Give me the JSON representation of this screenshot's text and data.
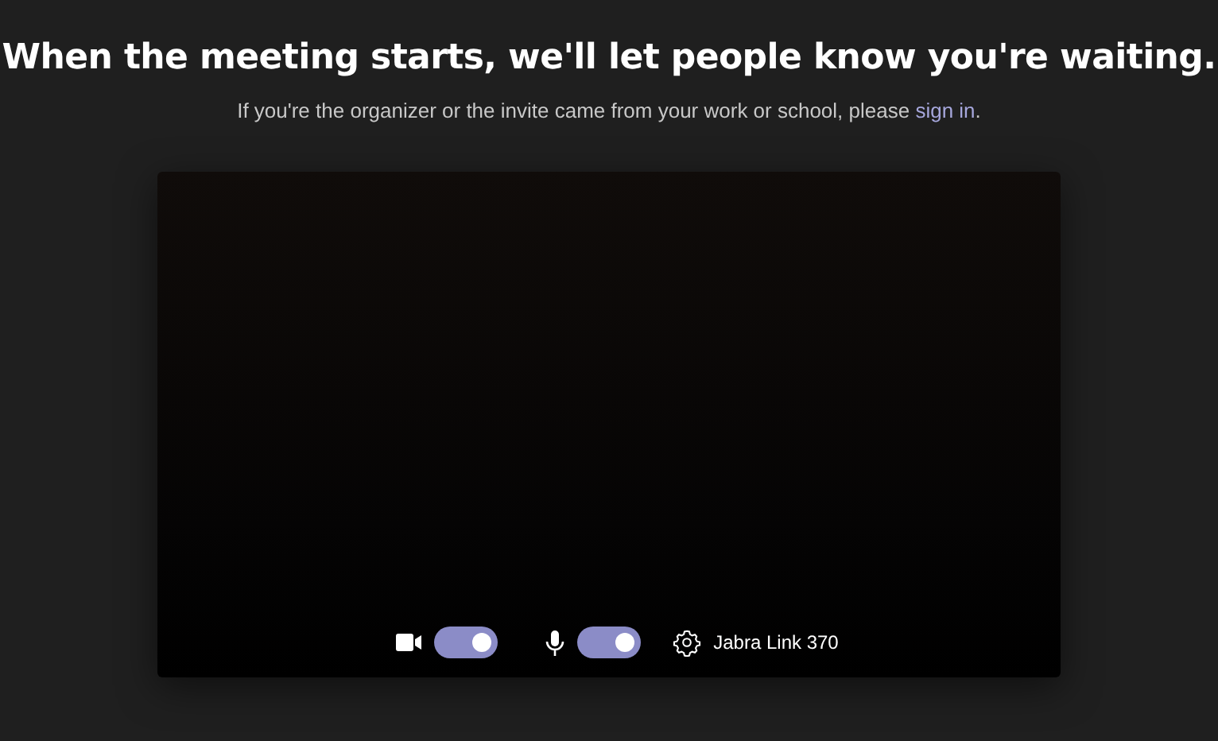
{
  "heading": "When the meeting starts, we'll let people know you're waiting.",
  "subtitle": {
    "before": "If you're the organizer or the invite came from your work or school, please ",
    "link": "sign in",
    "after": "."
  },
  "controls": [
    {
      "kind": "camera",
      "on": true
    },
    {
      "kind": "microphone",
      "on": true
    }
  ],
  "device": {
    "label": "Jabra Link 370"
  }
}
